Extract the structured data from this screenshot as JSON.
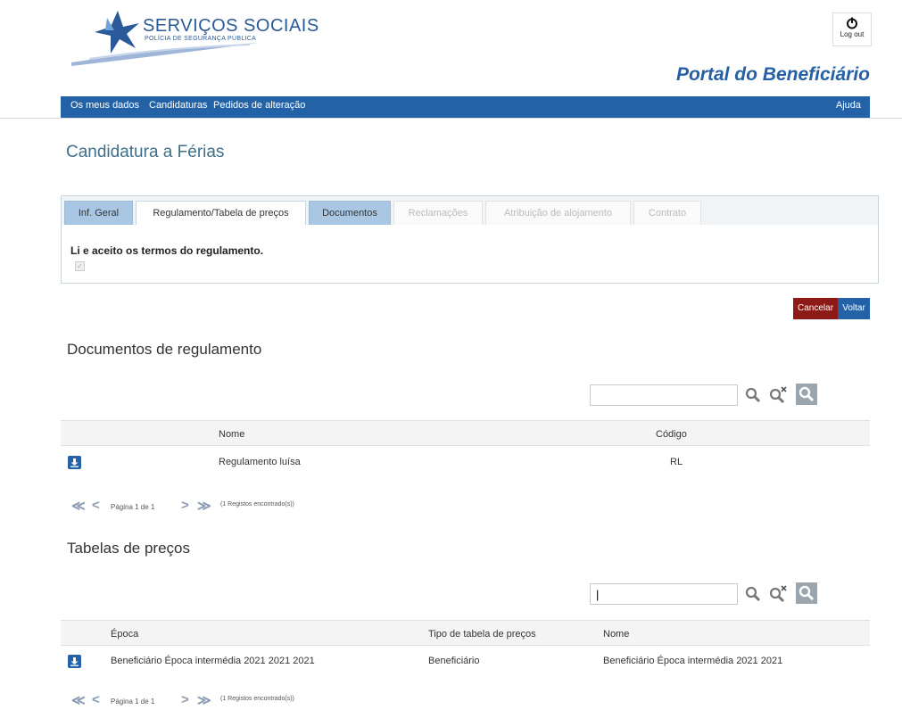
{
  "header": {
    "logo_title": "SERVIÇOS SOCIAIS",
    "logo_subtitle": "POLÍCIA DE SEGURANÇA PÚBLICA",
    "logout_label": "Log out",
    "portal_title": "Portal do Beneficiário"
  },
  "nav": {
    "items": [
      "Os meus dados",
      "Candidaturas",
      "Pedidos de alteração"
    ],
    "help": "Ajuda"
  },
  "page_title": "Candidatura a Férias",
  "tabs": [
    {
      "label": "Inf. Geral",
      "state": "enabled"
    },
    {
      "label": "Regulamento/Tabela de preços",
      "state": "active"
    },
    {
      "label": "Documentos",
      "state": "enabled"
    },
    {
      "label": "Reclamações",
      "state": "disabled"
    },
    {
      "label": "Atribuição de alojamento",
      "state": "disabled"
    },
    {
      "label": "Contrato",
      "state": "disabled"
    }
  ],
  "terms_text": "Li e aceito os termos do regulamento.",
  "terms_checked": true,
  "buttons": {
    "cancel": "Cancelar",
    "back": "Voltar"
  },
  "docs": {
    "title": "Documentos de regulamento",
    "search_value": "",
    "columns": [
      "Nome",
      "Código"
    ],
    "rows": [
      {
        "nome": "Regulamento luísa",
        "codigo": "RL"
      }
    ],
    "pager": {
      "page": "Página 1 de 1",
      "found": "(1 Registos encontrado(s))"
    }
  },
  "prices": {
    "title": "Tabelas de preços",
    "search_value": "|",
    "columns": [
      "Época",
      "Tipo de tabela de preços",
      "Nome"
    ],
    "rows": [
      {
        "epoca": "Beneficiário Época intermédia 2021 2021 2021",
        "tipo": "Beneficiário",
        "nome": "Beneficiário Época intermédia 2021 2021"
      }
    ],
    "pager": {
      "page": "Página 1 de 1",
      "found": "(1 Registos encontrado(s))"
    }
  },
  "colors": {
    "nav": "#2462a8",
    "cancel": "#8e1a18",
    "tab_blue": "#a9c7e3",
    "title_text": "#3f6f8a"
  },
  "icons": [
    "star-logo-icon",
    "power-icon",
    "search-icon",
    "clear-search-icon",
    "advanced-search-icon",
    "download-icon",
    "first-page-icon",
    "prev-page-icon",
    "next-page-icon",
    "last-page-icon"
  ]
}
